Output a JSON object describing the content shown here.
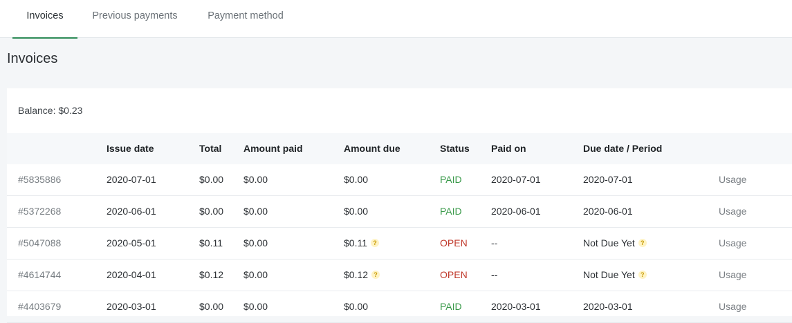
{
  "tabs": [
    {
      "label": "Invoices",
      "active": true
    },
    {
      "label": "Previous payments",
      "active": false
    },
    {
      "label": "Payment method",
      "active": false
    }
  ],
  "page_title": "Invoices",
  "balance": "Balance: $0.23",
  "colors": {
    "accent": "#2e8b57",
    "paid": "#3a9a4a",
    "open": "#c0392b",
    "help_badge": "#fff3c4"
  },
  "table": {
    "headers": {
      "invoice": "",
      "issue_date": "Issue date",
      "total": "Total",
      "amount_paid": "Amount paid",
      "amount_due": "Amount due",
      "status": "Status",
      "paid_on": "Paid on",
      "due_period": "Due date / Period",
      "action": ""
    },
    "rows": [
      {
        "invoice": "#5835886",
        "issue_date": "2020-07-01",
        "total": "$0.00",
        "amount_paid": "$0.00",
        "amount_due": "$0.00",
        "status": "PAID",
        "paid_on": "2020-07-01",
        "due_period": "2020-07-01",
        "action": "Usage"
      },
      {
        "invoice": "#5372268",
        "issue_date": "2020-06-01",
        "total": "$0.00",
        "amount_paid": "$0.00",
        "amount_due": "$0.00",
        "status": "PAID",
        "paid_on": "2020-06-01",
        "due_period": "2020-06-01",
        "action": "Usage"
      },
      {
        "invoice": "#5047088",
        "issue_date": "2020-05-01",
        "total": "$0.11",
        "amount_paid": "$0.00",
        "amount_due": "$0.11",
        "status": "OPEN",
        "paid_on": "--",
        "due_period": "Not Due Yet",
        "action": "Usage"
      },
      {
        "invoice": "#4614744",
        "issue_date": "2020-04-01",
        "total": "$0.12",
        "amount_paid": "$0.00",
        "amount_due": "$0.12",
        "status": "OPEN",
        "paid_on": "--",
        "due_period": "Not Due Yet",
        "action": "Usage"
      },
      {
        "invoice": "#4403679",
        "issue_date": "2020-03-01",
        "total": "$0.00",
        "amount_paid": "$0.00",
        "amount_due": "$0.00",
        "status": "PAID",
        "paid_on": "2020-03-01",
        "due_period": "2020-03-01",
        "action": "Usage"
      }
    ],
    "help_glyph": "?"
  }
}
